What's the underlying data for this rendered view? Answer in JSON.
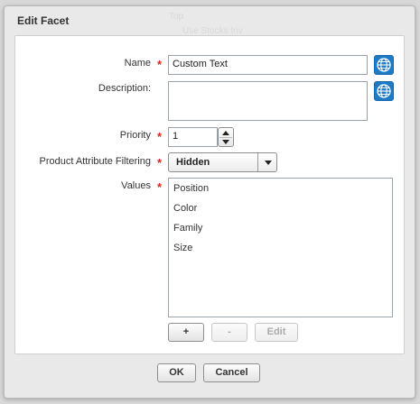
{
  "dialog": {
    "title": "Edit Facet",
    "background_hints": [
      "Top",
      "Use Stocks Inv"
    ]
  },
  "form": {
    "name": {
      "label": "Name",
      "value": "Custom Text"
    },
    "description": {
      "label": "Description:",
      "value": ""
    },
    "priority": {
      "label": "Priority",
      "value": "1"
    },
    "product_attribute_filtering": {
      "label": "Product Attribute Filtering",
      "selected": "Hidden"
    },
    "values": {
      "label": "Values",
      "items": [
        "Position",
        "Color",
        "Family",
        "Size"
      ]
    },
    "required_marker": "*"
  },
  "value_buttons": {
    "add": "+",
    "remove": "-",
    "edit": "Edit"
  },
  "footer": {
    "ok": "OK",
    "cancel": "Cancel"
  },
  "colors": {
    "accent": "#1f7ac6",
    "required": "#dd2222"
  },
  "icons": {
    "translate": "globe-icon",
    "stepper_up": "triangle-up-icon",
    "stepper_down": "triangle-down-icon",
    "dropdown": "triangle-down-icon"
  }
}
